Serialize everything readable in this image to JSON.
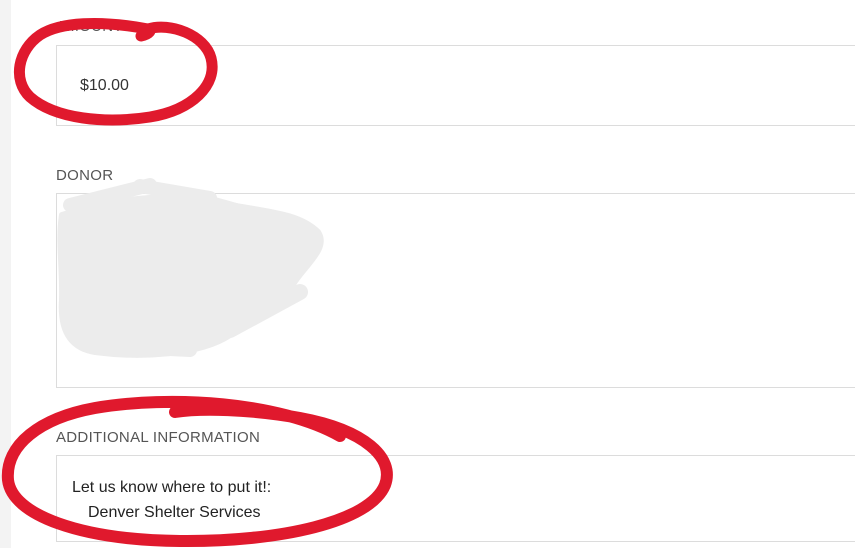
{
  "amount": {
    "label": "AMOUNT",
    "value": "$10.00"
  },
  "donor": {
    "label": "DONOR",
    "value": ""
  },
  "additional_information": {
    "label": "ADDITIONAL INFORMATION",
    "question": "Let us know where to put it!:",
    "answer": "Denver Shelter Services"
  },
  "colors": {
    "annotation_red": "#e0192d",
    "redaction_gray": "#ececec",
    "border": "#dcdcdc"
  }
}
